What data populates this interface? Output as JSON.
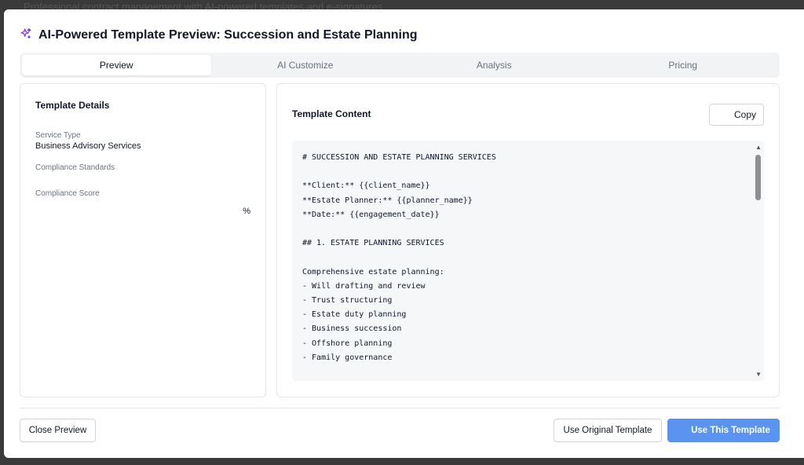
{
  "backdrop": {
    "subtitle": "Professional contract management with AI-powered templates and e-signatures"
  },
  "modal": {
    "title": "AI-Powered Template Preview: Succession and Estate Planning",
    "title_icon": "sparkles-icon",
    "tabs": [
      {
        "label": "Preview",
        "active": true
      },
      {
        "label": "AI Customize",
        "active": false
      },
      {
        "label": "Analysis",
        "active": false
      },
      {
        "label": "Pricing",
        "active": false
      }
    ]
  },
  "details": {
    "heading": "Template Details",
    "service_type_label": "Service Type",
    "service_type_value": "Business Advisory Services",
    "compliance_standards_label": "Compliance Standards",
    "compliance_score_label": "Compliance Score",
    "compliance_score_suffix": "%"
  },
  "content": {
    "heading": "Template Content",
    "copy_label": "Copy",
    "code": "# SUCCESSION AND ESTATE PLANNING SERVICES\n\n**Client:** {{client_name}}\n**Estate Planner:** {{planner_name}}\n**Date:** {{engagement_date}}\n\n## 1. ESTATE PLANNING SERVICES\n\nComprehensive estate planning:\n- Will drafting and review\n- Trust structuring\n- Estate duty planning\n- Business succession\n- Offshore planning\n- Family governance"
  },
  "footer": {
    "close_label": "Close Preview",
    "use_original_label": "Use Original Template",
    "use_this_label": "Use This Template"
  },
  "colors": {
    "primary": "#5a94f0",
    "tab_bg": "#f1f3f5",
    "code_bg": "#f6f7f9"
  }
}
